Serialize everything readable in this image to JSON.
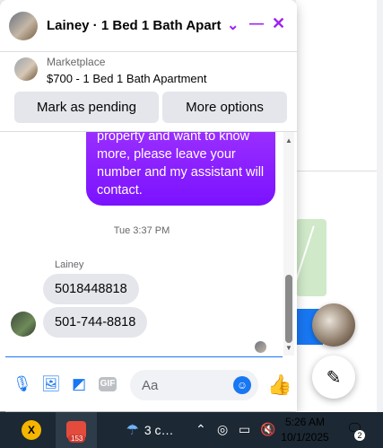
{
  "chat": {
    "title": "Lainey · 1 Bed 1 Bath Apart…",
    "header_icons": {
      "dropdown": "chevron-down-icon",
      "minimize": "minimize-icon",
      "close": "close-icon"
    }
  },
  "listing": {
    "label": "Marketplace",
    "title": "$700 - 1 Bed 1 Bath Apartment"
  },
  "actions": {
    "mark_pending": "Mark as pending",
    "more_options": "More options"
  },
  "messages": {
    "outgoing_text": "property and want to know more, please leave your number and my assistant will contact.",
    "timestamp": "Tue 3:37 PM",
    "sender": "Lainey",
    "incoming": [
      "5018448818",
      "501-744-8818"
    ]
  },
  "composer": {
    "placeholder": "Aa",
    "gif_label": "GIF"
  },
  "taskbar": {
    "app_badge": "153",
    "weather_text": "3 c…",
    "time": "5:26 AM",
    "date": "10/1/2025",
    "notifications": "2"
  },
  "colors": {
    "accent": "#a020f0",
    "bubble_purple": "#8a1dff",
    "messenger_blue": "#1877f2"
  }
}
